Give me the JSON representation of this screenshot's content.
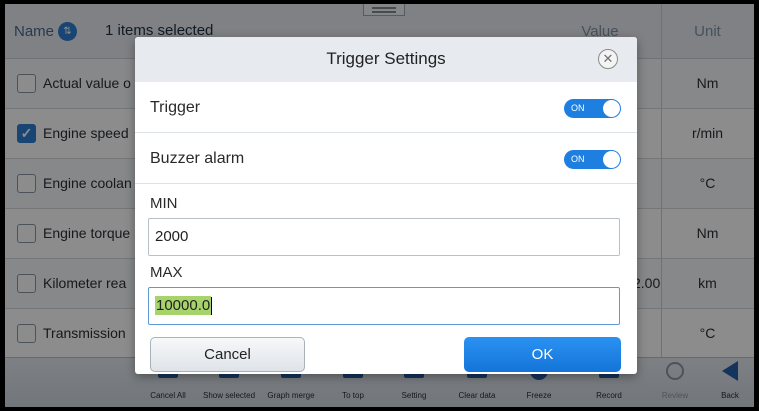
{
  "table": {
    "header": {
      "name_label": "Name",
      "selected_text": "1 items selected",
      "value_label": "Value",
      "unit_label": "Unit"
    },
    "rows": [
      {
        "name": "Actual value o",
        "value": "",
        "unit": "Nm",
        "checked": false
      },
      {
        "name": "Engine speed",
        "value": "",
        "unit": "r/min",
        "checked": true
      },
      {
        "name": "Engine coolan",
        "value": "",
        "unit": "°C",
        "checked": false
      },
      {
        "name": "Engine torque",
        "value": "",
        "unit": "Nm",
        "checked": false
      },
      {
        "name": "Kilometer rea",
        "value": "2.00",
        "unit": "km",
        "checked": false
      },
      {
        "name": "Transmission",
        "value": "",
        "unit": "°C",
        "checked": false
      }
    ]
  },
  "toolbar": {
    "items": [
      {
        "label": "Cancel All",
        "icon": "cancel-all-icon"
      },
      {
        "label": "Show selected",
        "icon": "show-selected-icon"
      },
      {
        "label": "Graph merge",
        "icon": "graph-merge-icon"
      },
      {
        "label": "To top",
        "icon": "to-top-icon"
      },
      {
        "label": "Setting",
        "icon": "setting-icon"
      },
      {
        "label": "Clear data",
        "icon": "clear-data-icon"
      },
      {
        "label": "Freeze",
        "icon": "freeze-icon"
      },
      {
        "label": "Record",
        "icon": "record-icon"
      },
      {
        "label": "Review",
        "icon": "review-icon"
      },
      {
        "label": "Back",
        "icon": "back-arrow-icon"
      }
    ]
  },
  "dialog": {
    "title": "Trigger Settings",
    "close_icon": "close-circle-icon",
    "trigger_label": "Trigger",
    "trigger_state": "ON",
    "buzzer_label": "Buzzer alarm",
    "buzzer_state": "ON",
    "min_label": "MIN",
    "min_value": "2000",
    "max_label": "MAX",
    "max_value": "10000.0",
    "cancel_label": "Cancel",
    "ok_label": "OK"
  },
  "colors": {
    "accent": "#1e7fe0",
    "ok_button": "#1a80e6",
    "selection_highlight": "#a6d46a"
  }
}
